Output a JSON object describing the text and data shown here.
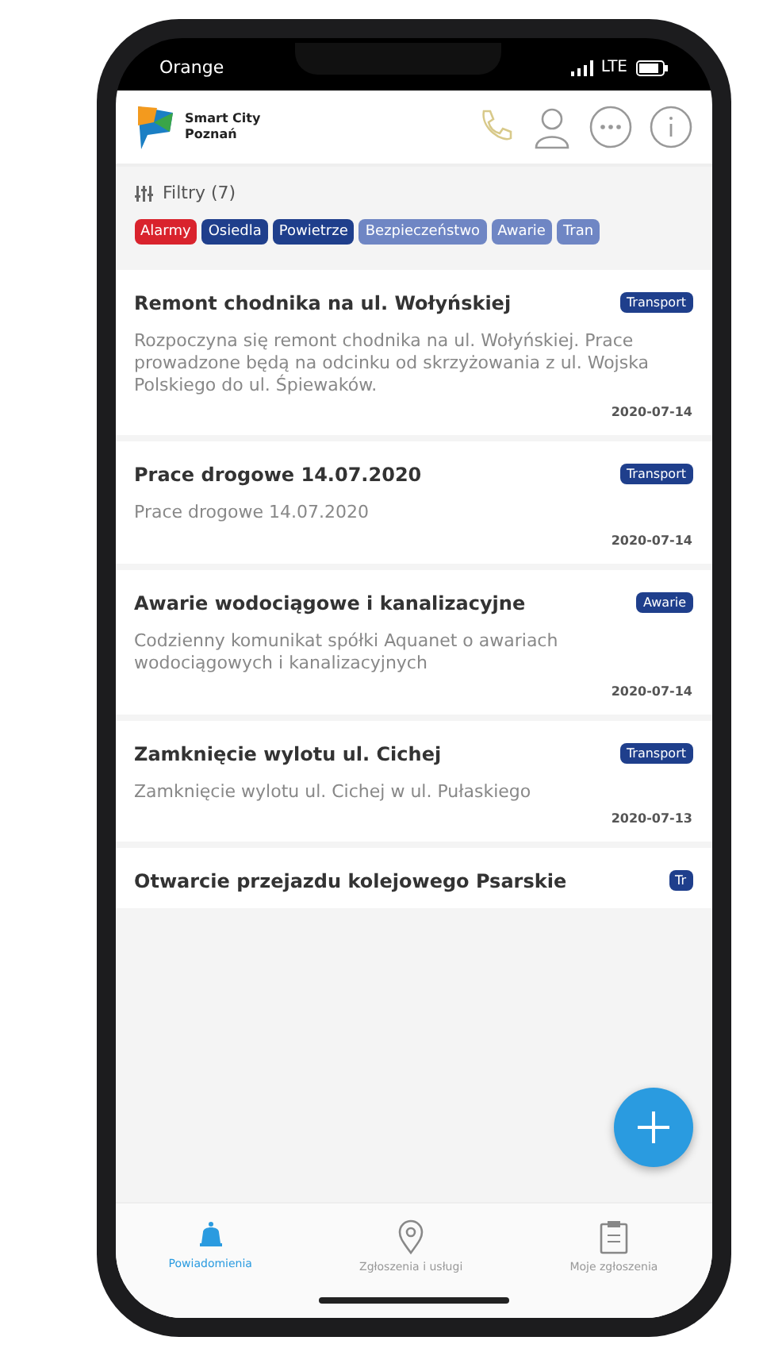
{
  "status_bar": {
    "carrier": "Orange",
    "network": "LTE"
  },
  "header": {
    "app_name": "Smart City",
    "city": "Poznań"
  },
  "filters": {
    "label": "Filtry (7)",
    "chips": [
      {
        "label": "Alarmy",
        "color": "#d9232d"
      },
      {
        "label": "Osiedla",
        "color": "#1f3f8c"
      },
      {
        "label": "Powietrze",
        "color": "#1f3f8c"
      },
      {
        "label": "Bezpieczeństwo",
        "color": "#6f86c4"
      },
      {
        "label": "Awarie",
        "color": "#6f86c4"
      },
      {
        "label": "Tran",
        "color": "#6f86c4"
      }
    ]
  },
  "notices": [
    {
      "title": "Remont chodnika na ul. Wołyńskiej",
      "tag": "Transport",
      "body": "Rozpoczyna się remont chodnika na ul. Wołyńskiej. Prace prowadzone będą na odcinku od skrzyżowania z ul. Wojska Polskiego do ul. Śpiewaków.",
      "date": "2020-07-14"
    },
    {
      "title": "Prace drogowe 14.07.2020",
      "tag": "Transport",
      "body": "Prace drogowe 14.07.2020",
      "date": "2020-07-14"
    },
    {
      "title": "Awarie wodociągowe i kanalizacyjne",
      "tag": "Awarie",
      "body": "Codzienny komunikat spółki Aquanet o awariach wodociągowych i kanalizacyjnych",
      "date": "2020-07-14"
    },
    {
      "title": "Zamknięcie wylotu ul. Cichej",
      "tag": "Transport",
      "body": "Zamknięcie wylotu ul. Cichej w ul. Pułaskiego",
      "date": "2020-07-13"
    },
    {
      "title": "Otwarcie przejazdu kolejowego Psarskie",
      "tag": "Tr"
    }
  ],
  "bottom_nav": [
    {
      "label": "Powiadomienia",
      "selected": true
    },
    {
      "label": "Zgłoszenia i usługi",
      "selected": false
    },
    {
      "label": "Moje zgłoszenia",
      "selected": false
    }
  ]
}
